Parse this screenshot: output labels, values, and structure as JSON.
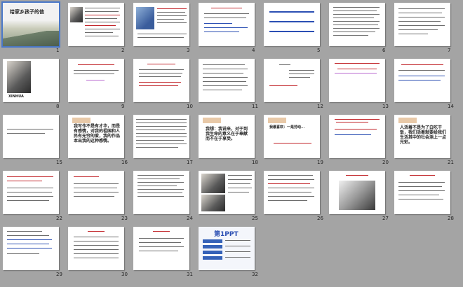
{
  "app": {
    "view": "slide-sorter"
  },
  "colors": {
    "background": "#a4a4a4",
    "slide": "#ffffff",
    "selection": "#4a78c8",
    "accent_red": "#c2262b",
    "accent_blue": "#2b4fb3",
    "tan": "#e8c9a8"
  },
  "slide1": {
    "title": "给家乡孩子的信"
  },
  "slide8": {
    "caption": "XINHUA"
  },
  "slide13": {
    "text": "我写作不是有才华，而是有感情，对我的祖国和人民有无穷的爱，我的作品本出我的这种感情。"
  },
  "slide14": {
    "text": "我想：我说来，对于到我生命的意义在于奉献而不在于享受。"
  },
  "slide15": {
    "text": "我最喜欢：一是劳动..."
  },
  "slide16": {
    "text": "人活着不是为了白吃干饭，我们活着就要给我们生活其中的社会添上一点光彩。"
  },
  "slide32": {
    "brand": "第1PPT"
  },
  "slides": [
    {
      "n": "1"
    },
    {
      "n": "2"
    },
    {
      "n": "3"
    },
    {
      "n": "4"
    },
    {
      "n": "5"
    },
    {
      "n": "6"
    },
    {
      "n": "7"
    },
    {
      "n": "8"
    },
    {
      "n": "9"
    },
    {
      "n": "10"
    },
    {
      "n": "11"
    },
    {
      "n": "12"
    },
    {
      "n": "13"
    },
    {
      "n": "14"
    },
    {
      "n": "15"
    },
    {
      "n": "16"
    },
    {
      "n": "17"
    },
    {
      "n": "18"
    },
    {
      "n": "19"
    },
    {
      "n": "20"
    },
    {
      "n": "21"
    },
    {
      "n": "22"
    },
    {
      "n": "23"
    },
    {
      "n": "24"
    },
    {
      "n": "25"
    },
    {
      "n": "26"
    },
    {
      "n": "27"
    },
    {
      "n": "28"
    },
    {
      "n": "29"
    },
    {
      "n": "30"
    },
    {
      "n": "31"
    },
    {
      "n": "32"
    }
  ]
}
